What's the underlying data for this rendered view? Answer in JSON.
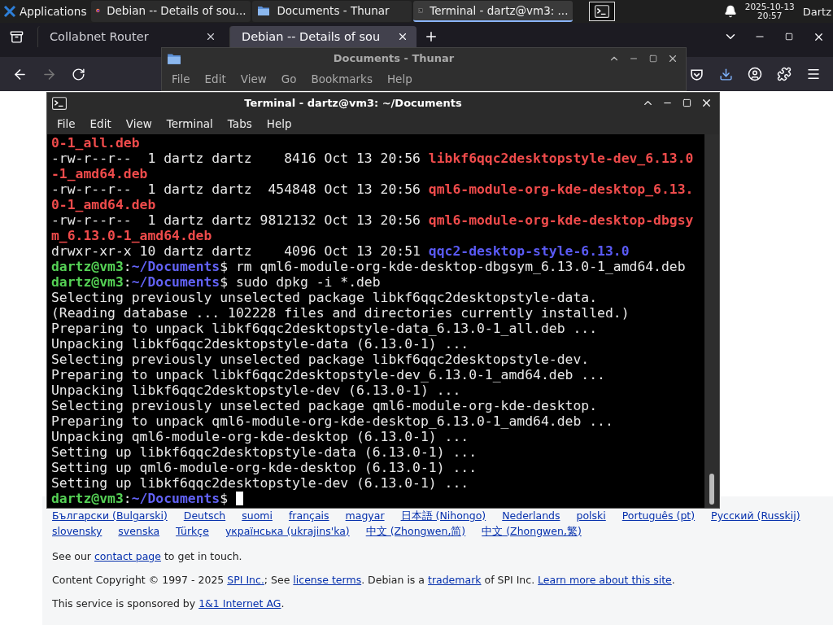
{
  "taskbar": {
    "menu_label": "Applications",
    "tasks": [
      {
        "kind": "firefox",
        "label": "Debian -- Details of sou...",
        "selected": false
      },
      {
        "kind": "folder",
        "label": "Documents - Thunar",
        "selected": false
      },
      {
        "kind": "terminal",
        "label": "Terminal - dartz@vm3: ...",
        "selected": true
      }
    ],
    "clock": {
      "date": "2025-10-13",
      "time": "20:57"
    },
    "user": "Dartz"
  },
  "browser": {
    "tabs": [
      {
        "label": "Collabnet Router",
        "selected": false
      },
      {
        "label": "Debian -- Details of sou",
        "selected": true
      }
    ],
    "footer": {
      "languages": [
        "Български (Bulgarski)",
        "Deutsch",
        "suomi",
        "français",
        "magyar",
        "日本語 (Nihongo)",
        "Nederlands",
        "polski",
        "Português (pt)",
        "Русский (Russkij)",
        "slovensky",
        "svenska",
        "Türkçe",
        "українська (ukrajins'ka)",
        "中文 (Zhongwen,简)",
        "中文 (Zhongwen,繁)"
      ],
      "paragraphs": [
        [
          {
            "text": "See our ",
            "link": false
          },
          {
            "text": "contact page",
            "link": true
          },
          {
            "text": " to get in touch.",
            "link": false
          }
        ],
        [
          {
            "text": "Content Copyright © 1997 - 2025 ",
            "link": false
          },
          {
            "text": "SPI Inc.",
            "link": true
          },
          {
            "text": "; See ",
            "link": false
          },
          {
            "text": "license terms",
            "link": true
          },
          {
            "text": ". Debian is a ",
            "link": false
          },
          {
            "text": "trademark",
            "link": true
          },
          {
            "text": " of SPI Inc. ",
            "link": false
          },
          {
            "text": "Learn more about this site",
            "link": true
          },
          {
            "text": ".",
            "link": false
          }
        ],
        [
          {
            "text": "This service is sponsored by ",
            "link": false
          },
          {
            "text": "1&1 Internet AG",
            "link": true
          },
          {
            "text": ".",
            "link": false
          }
        ]
      ]
    }
  },
  "thunar": {
    "title": "Documents - Thunar",
    "menu": [
      "File",
      "Edit",
      "View",
      "Go",
      "Bookmarks",
      "Help"
    ]
  },
  "terminal": {
    "title": "Terminal - dartz@vm3: ~/Documents",
    "menu": [
      "File",
      "Edit",
      "View",
      "Terminal",
      "Tabs",
      "Help"
    ],
    "lines": [
      {
        "segments": [
          {
            "kind": "file",
            "text": "0-1_all.deb"
          }
        ]
      },
      {
        "segments": [
          {
            "kind": "plain",
            "text": "-rw-r--r--  1 dartz dartz    8416 Oct 13 20:56 "
          },
          {
            "kind": "file",
            "text": "libkf6qqc2desktopstyle-dev_6.13.0"
          }
        ]
      },
      {
        "segments": [
          {
            "kind": "file",
            "text": "-1_amd64.deb"
          }
        ]
      },
      {
        "segments": [
          {
            "kind": "plain",
            "text": "-rw-r--r--  1 dartz dartz  454848 Oct 13 20:56 "
          },
          {
            "kind": "file",
            "text": "qml6-module-org-kde-desktop_6.13."
          }
        ]
      },
      {
        "segments": [
          {
            "kind": "file",
            "text": "0-1_amd64.deb"
          }
        ]
      },
      {
        "segments": [
          {
            "kind": "plain",
            "text": "-rw-r--r--  1 dartz dartz 9812132 Oct 13 20:56 "
          },
          {
            "kind": "file",
            "text": "qml6-module-org-kde-desktop-dbgsy"
          }
        ]
      },
      {
        "segments": [
          {
            "kind": "file",
            "text": "m_6.13.0-1_amd64.deb"
          }
        ]
      },
      {
        "segments": [
          {
            "kind": "plain",
            "text": "drwxr-xr-x 10 dartz dartz    4096 Oct 13 20:51 "
          },
          {
            "kind": "dir",
            "text": "qqc2-desktop-style-6.13.0"
          }
        ]
      },
      {
        "segments": [
          {
            "kind": "user",
            "text": "dartz@vm3"
          },
          {
            "kind": "plain",
            "text": ":"
          },
          {
            "kind": "path",
            "text": "~/Documents"
          },
          {
            "kind": "plain",
            "text": "$ rm qml6-module-org-kde-desktop-dbgsym_6.13.0-1_amd64.deb"
          }
        ]
      },
      {
        "segments": [
          {
            "kind": "user",
            "text": "dartz@vm3"
          },
          {
            "kind": "plain",
            "text": ":"
          },
          {
            "kind": "path",
            "text": "~/Documents"
          },
          {
            "kind": "plain",
            "text": "$ sudo dpkg -i *.deb"
          }
        ]
      },
      {
        "segments": [
          {
            "kind": "plain",
            "text": "Selecting previously unselected package libkf6qqc2desktopstyle-data."
          }
        ]
      },
      {
        "segments": [
          {
            "kind": "plain",
            "text": "(Reading database ... 102228 files and directories currently installed.)"
          }
        ]
      },
      {
        "segments": [
          {
            "kind": "plain",
            "text": "Preparing to unpack libkf6qqc2desktopstyle-data_6.13.0-1_all.deb ..."
          }
        ]
      },
      {
        "segments": [
          {
            "kind": "plain",
            "text": "Unpacking libkf6qqc2desktopstyle-data (6.13.0-1) ..."
          }
        ]
      },
      {
        "segments": [
          {
            "kind": "plain",
            "text": "Selecting previously unselected package libkf6qqc2desktopstyle-dev."
          }
        ]
      },
      {
        "segments": [
          {
            "kind": "plain",
            "text": "Preparing to unpack libkf6qqc2desktopstyle-dev_6.13.0-1_amd64.deb ..."
          }
        ]
      },
      {
        "segments": [
          {
            "kind": "plain",
            "text": "Unpacking libkf6qqc2desktopstyle-dev (6.13.0-1) ..."
          }
        ]
      },
      {
        "segments": [
          {
            "kind": "plain",
            "text": "Selecting previously unselected package qml6-module-org-kde-desktop."
          }
        ]
      },
      {
        "segments": [
          {
            "kind": "plain",
            "text": "Preparing to unpack qml6-module-org-kde-desktop_6.13.0-1_amd64.deb ..."
          }
        ]
      },
      {
        "segments": [
          {
            "kind": "plain",
            "text": "Unpacking qml6-module-org-kde-desktop (6.13.0-1) ..."
          }
        ]
      },
      {
        "segments": [
          {
            "kind": "plain",
            "text": "Setting up libkf6qqc2desktopstyle-data (6.13.0-1) ..."
          }
        ]
      },
      {
        "segments": [
          {
            "kind": "plain",
            "text": "Setting up qml6-module-org-kde-desktop (6.13.0-1) ..."
          }
        ]
      },
      {
        "segments": [
          {
            "kind": "plain",
            "text": "Setting up libkf6qqc2desktopstyle-dev (6.13.0-1) ..."
          }
        ]
      },
      {
        "segments": [
          {
            "kind": "user",
            "text": "dartz@vm3"
          },
          {
            "kind": "plain",
            "text": ":"
          },
          {
            "kind": "path",
            "text": "~/Documents"
          },
          {
            "kind": "plain",
            "text": "$ "
          }
        ],
        "cursor": true
      }
    ]
  }
}
